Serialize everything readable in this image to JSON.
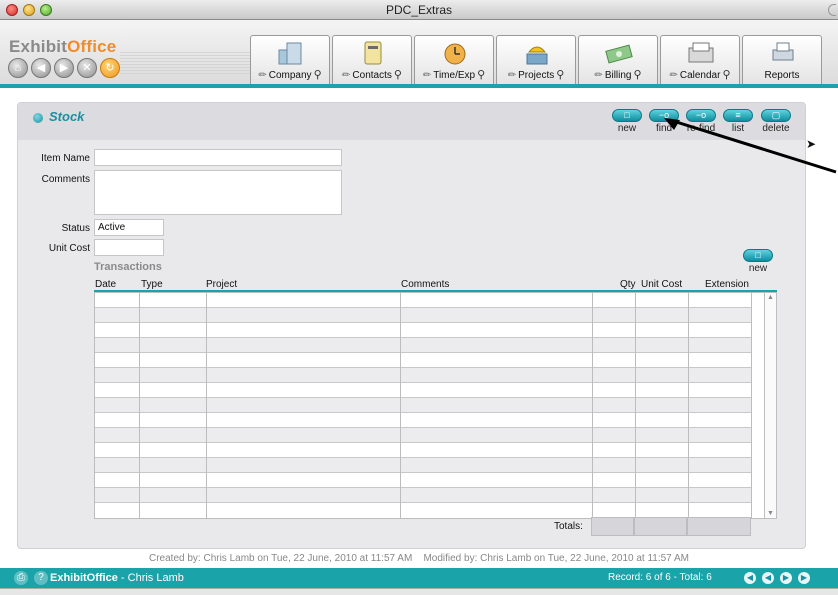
{
  "window": {
    "title": "PDC_Extras"
  },
  "brand": {
    "name_part1": "Exhibit",
    "name_part2": "Office"
  },
  "nav_buttons": [
    "home",
    "back",
    "forward",
    "close",
    "refresh"
  ],
  "modules": [
    {
      "label": "Company",
      "icon": "building-icon",
      "searchable": true
    },
    {
      "label": "Contacts",
      "icon": "contacts-icon",
      "searchable": true
    },
    {
      "label": "Time/Exp",
      "icon": "clock-icon",
      "searchable": true
    },
    {
      "label": "Projects",
      "icon": "worker-icon",
      "searchable": true
    },
    {
      "label": "Billing",
      "icon": "money-icon",
      "searchable": true
    },
    {
      "label": "Calendar",
      "icon": "calendar-icon",
      "searchable": true
    },
    {
      "label": "Reports",
      "icon": "printer-icon",
      "searchable": false
    }
  ],
  "panel": {
    "title": "Stock",
    "actions": [
      {
        "label": "new",
        "icon": "folder-icon"
      },
      {
        "label": "find",
        "icon": "key-icon"
      },
      {
        "label": "re-find",
        "icon": "key-icon"
      },
      {
        "label": "list",
        "icon": "list-icon"
      },
      {
        "label": "delete",
        "icon": "trash-icon"
      }
    ]
  },
  "form": {
    "item_name_label": "Item Name",
    "item_name_value": "",
    "comments_label": "Comments",
    "comments_value": "",
    "status_label": "Status",
    "status_value": "Active",
    "unit_cost_label": "Unit Cost",
    "unit_cost_value": ""
  },
  "transactions": {
    "title": "Transactions",
    "new_label": "new",
    "columns": [
      "Date",
      "Type",
      "Project",
      "Comments",
      "Qty",
      "Unit Cost",
      "Extension"
    ],
    "rows": [],
    "totals_label": "Totals:"
  },
  "meta": {
    "created": "Created by: Chris Lamb on Tue, 22 June, 2010 at 11:57 AM",
    "modified": "Modified by: Chris Lamb on Tue, 22 June, 2010 at 11:57 AM"
  },
  "statusbar": {
    "app": "ExhibitOffice",
    "separator": "-",
    "user": "Chris Lamb",
    "record": "Record: 6 of 6  -  Total: 6"
  },
  "colors": {
    "accent": "#1aa3a8",
    "brand_orange": "#f28c28",
    "brand_gray": "#8a8a8a"
  }
}
